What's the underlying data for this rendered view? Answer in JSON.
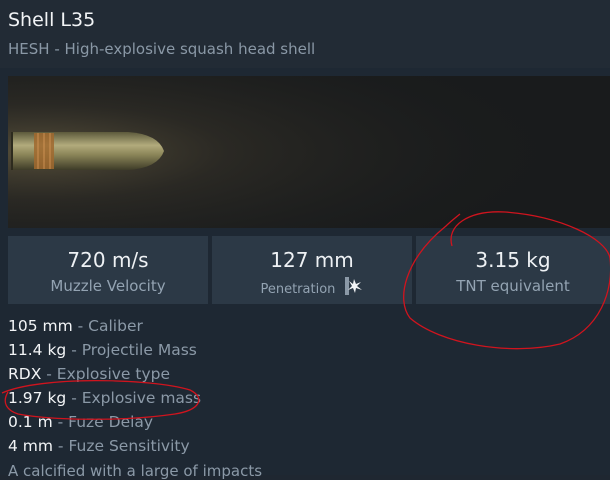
{
  "header": {
    "title": "Shell L35",
    "subtitle": "HESH - High-explosive squash head shell"
  },
  "shell_image_icon": "shell-projectile-icon",
  "stats": [
    {
      "value": "720 m/s",
      "label": "Muzzle Velocity"
    },
    {
      "value": "127 mm",
      "label": "Penetration",
      "icon": "penetration-burst-icon"
    },
    {
      "value": "3.15 kg",
      "label": "TNT equivalent"
    }
  ],
  "properties": [
    {
      "value": "105 mm",
      "sep": " - ",
      "label": "Caliber"
    },
    {
      "value": "11.4 kg",
      "sep": " - ",
      "label": "Projectile Mass"
    },
    {
      "value": "RDX",
      "sep": " - ",
      "label": "Explosive type"
    },
    {
      "value": "1.97 kg",
      "sep": " - ",
      "label": "Explosive mass"
    },
    {
      "value": "0.1 m",
      "sep": " - ",
      "label": "Fuze Delay"
    },
    {
      "value": "4 mm",
      "sep": " - ",
      "label": "Fuze Sensitivity"
    }
  ],
  "description": "A calcified with a large of impacts",
  "colors": {
    "annotation": "#d0141e",
    "value_text": "#f2f4f6",
    "label_text": "#8b99a7",
    "stat_bg": "#2c3946"
  }
}
